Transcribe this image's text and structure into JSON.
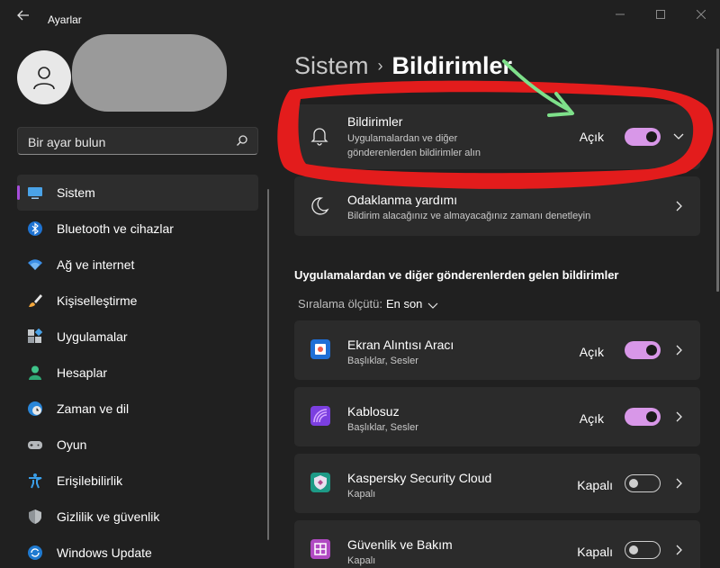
{
  "window": {
    "app_title": "Ayarlar"
  },
  "sidebar": {
    "search_placeholder": "Bir ayar bulun",
    "items": [
      {
        "label": "Sistem",
        "icon": "monitor-icon",
        "active": true
      },
      {
        "label": "Bluetooth ve cihazlar",
        "icon": "bluetooth-icon"
      },
      {
        "label": "Ağ ve internet",
        "icon": "wifi-icon"
      },
      {
        "label": "Kişiselleştirme",
        "icon": "brush-icon"
      },
      {
        "label": "Uygulamalar",
        "icon": "apps-icon"
      },
      {
        "label": "Hesaplar",
        "icon": "person-icon"
      },
      {
        "label": "Zaman ve dil",
        "icon": "globe-clock-icon"
      },
      {
        "label": "Oyun",
        "icon": "gamepad-icon"
      },
      {
        "label": "Erişilebilirlik",
        "icon": "accessibility-icon"
      },
      {
        "label": "Gizlilik ve güvenlik",
        "icon": "shield-icon"
      },
      {
        "label": "Windows Update",
        "icon": "update-icon"
      }
    ]
  },
  "main": {
    "breadcrumb_parent": "Sistem",
    "breadcrumb_sep": "›",
    "breadcrumb_current": "Bildirimler",
    "notifications_card": {
      "title": "Bildirimler",
      "subtitle_line1": "Uygulamalardan ve diğer",
      "subtitle_line2": "gönderenlerden bildirimler alın",
      "state": "Açık",
      "toggle_on": true
    },
    "focus_card": {
      "title": "Odaklanma yardımı",
      "subtitle": "Bildirim alacağınız ve almayacağınız zamanı denetleyin"
    },
    "section_title": "Uygulamalardan ve diğer gönderenlerden gelen bildirimler",
    "sort_label": "Sıralama ölçütü:",
    "sort_value": "En son",
    "apps": [
      {
        "name": "Ekran Alıntısı Aracı",
        "detail": "Başlıklar, Sesler",
        "state": "Açık",
        "on": true,
        "icon": "snipping-tool-icon"
      },
      {
        "name": "Kablosuz",
        "detail": "Başlıklar, Sesler",
        "state": "Açık",
        "on": true,
        "icon": "wireless-icon"
      },
      {
        "name": "Kaspersky Security Cloud",
        "detail": "Kapalı",
        "state": "Kapalı",
        "on": false,
        "icon": "kaspersky-icon"
      },
      {
        "name": "Güvenlik ve Bakım",
        "detail": "Kapalı",
        "state": "Kapalı",
        "on": false,
        "icon": "security-maintenance-icon"
      }
    ]
  },
  "colors": {
    "accent": "#d897e8",
    "active_indicator": "#a64ddb",
    "annotation_red": "#e31c1c",
    "annotation_green": "#7ee08a"
  }
}
